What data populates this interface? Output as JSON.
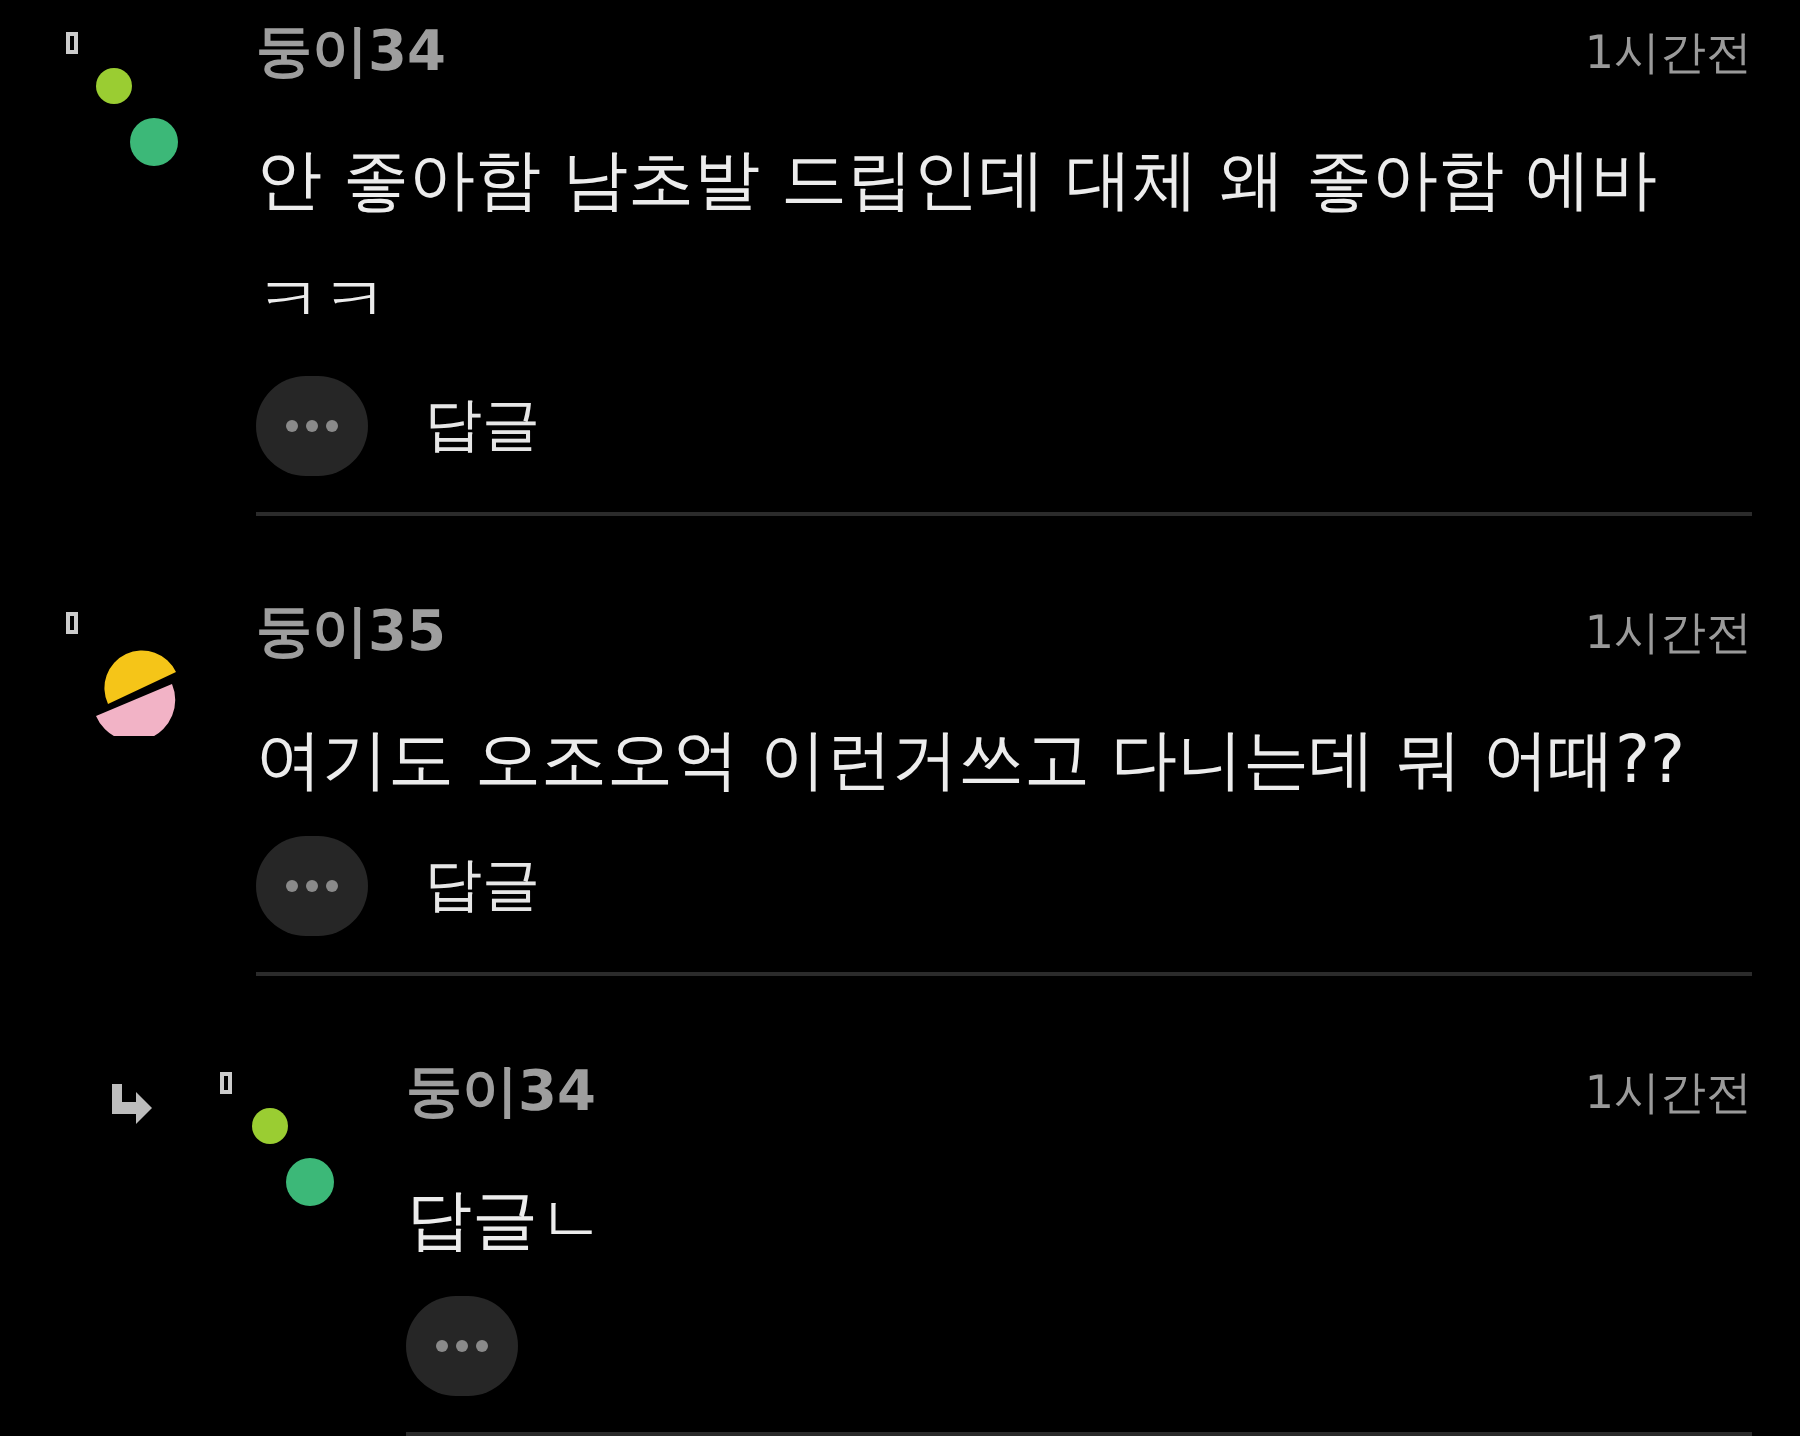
{
  "comments": [
    {
      "author": "둥이34",
      "time": "1시간전",
      "text": "안 좋아함 남초발 드립인데 대체 왜 좋아함 에바 ㅋㅋ",
      "reply_label": "답글",
      "is_reply": false,
      "avatar": {
        "kind": "dots"
      }
    },
    {
      "author": "둥이35",
      "time": "1시간전",
      "text": "여기도 오조오억 이런거쓰고 다니는데 뭐 어때??",
      "reply_label": "답글",
      "is_reply": false,
      "avatar": {
        "kind": "halves"
      }
    },
    {
      "author": "둥이34",
      "time": "1시간전",
      "text": "답글ㄴ",
      "is_reply": true,
      "avatar": {
        "kind": "dots"
      }
    }
  ]
}
